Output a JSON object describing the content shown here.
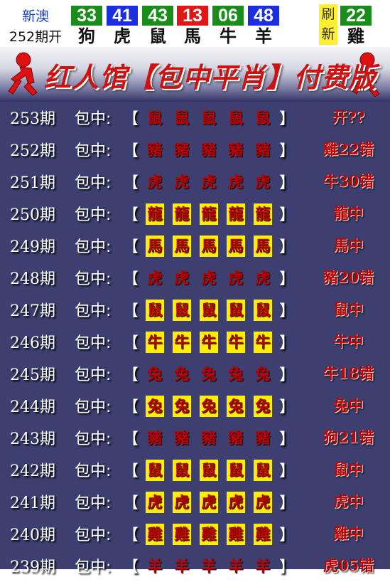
{
  "header": {
    "label_top": "新澳",
    "label_bottom": "252期开",
    "balls": [
      {
        "num": "33",
        "zodiac": "狗",
        "color": "#1a8c1a"
      },
      {
        "num": "41",
        "zodiac": "虎",
        "color": "#1b2fe0"
      },
      {
        "num": "43",
        "zodiac": "鼠",
        "color": "#1a8c1a"
      },
      {
        "num": "13",
        "zodiac": "馬",
        "color": "#e01717"
      },
      {
        "num": "06",
        "zodiac": "牛",
        "color": "#1a8c1a"
      },
      {
        "num": "48",
        "zodiac": "羊",
        "color": "#1b2fe0"
      }
    ],
    "refresh_top": "刷",
    "refresh_bottom": "新",
    "special": {
      "num": "22",
      "zodiac": "雞",
      "color": "#1a8c1a"
    }
  },
  "banner": {
    "title": "红人馆【包中平肖】付费版"
  },
  "rows": [
    {
      "period": "253期",
      "label": "包中:",
      "open": "【",
      "close": "】",
      "zodiacs": [
        "鼠",
        "鼠",
        "鼠",
        "鼠",
        "鼠"
      ],
      "highlight": false,
      "result": "开??"
    },
    {
      "period": "252期",
      "label": "包中:",
      "open": "【",
      "close": "】",
      "zodiacs": [
        "豬",
        "豬",
        "豬",
        "豬",
        "豬"
      ],
      "highlight": false,
      "result": "雞22错"
    },
    {
      "period": "251期",
      "label": "包中:",
      "open": "【",
      "close": "】",
      "zodiacs": [
        "虎",
        "虎",
        "虎",
        "虎",
        "虎"
      ],
      "highlight": false,
      "result": "牛30错"
    },
    {
      "period": "250期",
      "label": "包中:",
      "open": "【",
      "close": "】",
      "zodiacs": [
        "龍",
        "龍",
        "龍",
        "龍",
        "龍"
      ],
      "highlight": true,
      "result": "龍中"
    },
    {
      "period": "249期",
      "label": "包中:",
      "open": "【",
      "close": "】",
      "zodiacs": [
        "馬",
        "馬",
        "馬",
        "馬",
        "馬"
      ],
      "highlight": true,
      "result": "馬中"
    },
    {
      "period": "248期",
      "label": "包中:",
      "open": "【",
      "close": "】",
      "zodiacs": [
        "虎",
        "虎",
        "虎",
        "虎",
        "虎"
      ],
      "highlight": false,
      "result": "豬20错"
    },
    {
      "period": "247期",
      "label": "包中:",
      "open": "【",
      "close": "】",
      "zodiacs": [
        "鼠",
        "鼠",
        "鼠",
        "鼠",
        "鼠"
      ],
      "highlight": true,
      "result": "鼠中"
    },
    {
      "period": "246期",
      "label": "包中:",
      "open": "【",
      "close": "】",
      "zodiacs": [
        "牛",
        "牛",
        "牛",
        "牛",
        "牛"
      ],
      "highlight": true,
      "result": "牛中"
    },
    {
      "period": "245期",
      "label": "包中:",
      "open": "【",
      "close": "】",
      "zodiacs": [
        "兔",
        "兔",
        "兔",
        "兔",
        "兔"
      ],
      "highlight": false,
      "result": "牛18错"
    },
    {
      "period": "244期",
      "label": "包中:",
      "open": "【",
      "close": "】",
      "zodiacs": [
        "兔",
        "兔",
        "兔",
        "兔",
        "兔"
      ],
      "highlight": true,
      "result": "兔中"
    },
    {
      "period": "243期",
      "label": "包中:",
      "open": "【",
      "close": "】",
      "zodiacs": [
        "豬",
        "豬",
        "豬",
        "豬",
        "豬"
      ],
      "highlight": false,
      "result": "狗21错"
    },
    {
      "period": "242期",
      "label": "包中:",
      "open": "【",
      "close": "】",
      "zodiacs": [
        "鼠",
        "鼠",
        "鼠",
        "鼠",
        "鼠"
      ],
      "highlight": true,
      "result": "鼠中"
    },
    {
      "period": "241期",
      "label": "包中:",
      "open": "【",
      "close": "】",
      "zodiacs": [
        "虎",
        "虎",
        "虎",
        "虎",
        "虎"
      ],
      "highlight": true,
      "result": "虎中"
    },
    {
      "period": "240期",
      "label": "包中:",
      "open": "【",
      "close": "】",
      "zodiacs": [
        "雞",
        "雞",
        "雞",
        "雞",
        "雞"
      ],
      "highlight": true,
      "result": "雞中"
    },
    {
      "period": "239期",
      "label": "包中:",
      "open": "【",
      "close": "】",
      "zodiacs": [
        "羊",
        "羊",
        "羊",
        "羊",
        "羊"
      ],
      "highlight": false,
      "result": "虎05错"
    }
  ]
}
